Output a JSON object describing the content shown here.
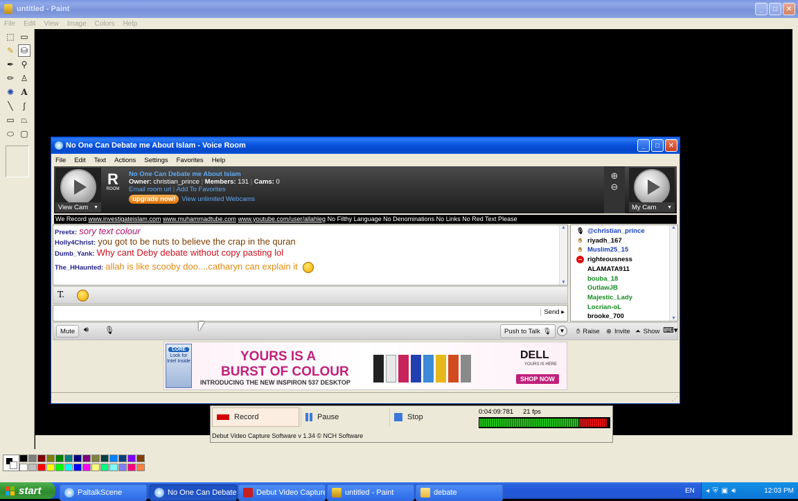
{
  "paint": {
    "title": "untitled - Paint",
    "menu": [
      "File",
      "Edit",
      "View",
      "Image",
      "Colors",
      "Help"
    ]
  },
  "paltalk": {
    "title": "No One Can Debate me About Islam - Voice Room",
    "menu": [
      "File",
      "Edit",
      "Text",
      "Actions",
      "Settings",
      "Favorites",
      "Help"
    ],
    "view_cam": "View Cam",
    "my_cam": "My Cam",
    "room_badge_letter": "R",
    "room_badge_word": "ROOM",
    "room_name": "No One Can Debate me About Islam",
    "owner_label": "Owner:",
    "owner": "christian_prince",
    "members_label": "Members:",
    "members": "131",
    "cams_label": "Cams:",
    "cams": "0",
    "email_link": "Email room url",
    "favorites_link": "Add To Favorites",
    "upgrade": "upgrade now!",
    "webcams_link": "View unlimited Webcams",
    "topic_prefix": "We Record",
    "topic_link1": "www.investigateislam.com",
    "topic_link2": "www.muhammadtube.com",
    "topic_link3": "www.youtube.com/user/allahleg",
    "topic_suffix": "No Filthy Language No Denominations No Links No Red Text Please",
    "messages": [
      {
        "nick": "Preetx:",
        "text": "sory text colour",
        "color": "#b0106a"
      },
      {
        "nick": "Holly4Christ:",
        "text": "you got to be nuts to believe the crap in the quran",
        "color": "#7a3d00"
      },
      {
        "nick": "Dumb_Yank:",
        "text": "Why cant Deby debate without copy pasting lol",
        "color": "#c8101e"
      },
      {
        "nick": "The_HHaunted:",
        "text": "allah is like scooby doo....catharyn can explain it",
        "color": "#e08a12"
      }
    ],
    "users": [
      {
        "name": "@christian_prince",
        "color": "#1a3fb8",
        "icon": "mic"
      },
      {
        "name": "riyadh_167",
        "color": "#000000",
        "icon": "hand"
      },
      {
        "name": "Muslim25_15",
        "color": "#1a3fb8",
        "icon": "hand"
      },
      {
        "name": "righteousness",
        "color": "#000000",
        "icon": "block"
      },
      {
        "name": "ALAMATA911",
        "color": "#000000",
        "icon": "none"
      },
      {
        "name": "bouba_18",
        "color": "#178a22",
        "icon": "none"
      },
      {
        "name": "OutlawJB",
        "color": "#178a22",
        "icon": "none"
      },
      {
        "name": "Majestic_Lady",
        "color": "#178a22",
        "icon": "none"
      },
      {
        "name": "Locrian-oL",
        "color": "#178a22",
        "icon": "none"
      },
      {
        "name": "brooke_700",
        "color": "#000000",
        "icon": "none"
      }
    ],
    "send": "Send",
    "mute": "Mute",
    "push_to_talk": "Push to Talk",
    "raise": "Raise",
    "invite": "Invite",
    "show": "Show"
  },
  "ad": {
    "intel_core": "CORE",
    "intel_look": "Look for Intel Inside",
    "headline1": "YOURS IS A",
    "headline2": "BURST OF COLOUR",
    "subline": "INTRODUCING THE NEW INSPIRON 537 DESKTOP",
    "brand": "DELL",
    "brand_tag": "YOURS IS HERE",
    "cta": "SHOP NOW"
  },
  "debut": {
    "record": "Record",
    "pause": "Pause",
    "stop": "Stop",
    "time": "0:04:09:781",
    "fps": "21 fps",
    "status": "Debut Video Capture Software v 1.34 © NCH Software"
  },
  "taskbar": {
    "start": "start",
    "items": [
      "PaltalkScene",
      "No One Can Debate ...",
      "Debut Video Capture ...",
      "untitled - Paint",
      "debate"
    ],
    "lang": "EN",
    "clock": "12:03 PM"
  },
  "colors": {
    "xp_blue": "#0a55de",
    "start_green": "#3c9a3c",
    "upgrade_orange": "#f08a18",
    "dell_purple": "#c0207a"
  }
}
